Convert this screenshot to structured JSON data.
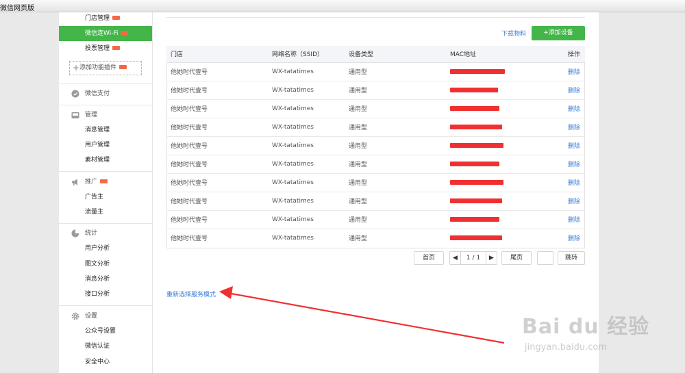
{
  "window": {
    "title": "微信网页版"
  },
  "sidebar": {
    "top_items": [
      {
        "label": "门店管理",
        "badge": true
      },
      {
        "label": "微信连Wi-Fi",
        "badge": true,
        "active": true
      },
      {
        "label": "投票管理",
        "badge": true
      }
    ],
    "add_plugin_label": "添加功能插件",
    "sections": [
      {
        "title": "微信支付",
        "icon": "wallet-icon",
        "items": []
      },
      {
        "title": "管理",
        "icon": "inbox-icon",
        "items": [
          "消息管理",
          "用户管理",
          "素材管理"
        ]
      },
      {
        "title": "推广",
        "icon": "megaphone-icon",
        "badge": true,
        "items": [
          "广告主",
          "流量主"
        ]
      },
      {
        "title": "统计",
        "icon": "pie-chart-icon",
        "items": [
          "用户分析",
          "图文分析",
          "消息分析",
          "接口分析"
        ]
      },
      {
        "title": "设置",
        "icon": "gear-icon",
        "items": [
          "公众号设置",
          "微信认证",
          "安全中心"
        ]
      }
    ]
  },
  "toolbar": {
    "download_label": "下载物料",
    "add_device_label": "添加设备"
  },
  "table": {
    "columns": [
      "门店",
      "网络名称（SSID）",
      "设备类型",
      "MAC地址",
      "操作"
    ],
    "rows": [
      {
        "store": "他她时代壹号",
        "ssid": "WX-tatatimes",
        "type": "通用型",
        "op": "删除"
      },
      {
        "store": "他她时代壹号",
        "ssid": "WX-tatatimes",
        "type": "通用型",
        "op": "删除"
      },
      {
        "store": "他她时代壹号",
        "ssid": "WX-tatatimes",
        "type": "通用型",
        "op": "删除"
      },
      {
        "store": "他她时代壹号",
        "ssid": "WX-tatatimes",
        "type": "通用型",
        "op": "删除"
      },
      {
        "store": "他她时代壹号",
        "ssid": "WX-tatatimes",
        "type": "通用型",
        "op": "删除"
      },
      {
        "store": "他她时代壹号",
        "ssid": "WX-tatatimes",
        "type": "通用型",
        "op": "删除"
      },
      {
        "store": "他她时代壹号",
        "ssid": "WX-tatatimes",
        "type": "通用型",
        "op": "删除"
      },
      {
        "store": "他她时代壹号",
        "ssid": "WX-tatatimes",
        "type": "通用型",
        "op": "删除"
      },
      {
        "store": "他她时代壹号",
        "ssid": "WX-tatatimes",
        "type": "通用型",
        "op": "删除"
      },
      {
        "store": "他她时代壹号",
        "ssid": "WX-tatatimes",
        "type": "通用型",
        "op": "删除"
      }
    ]
  },
  "pagination": {
    "first": "首页",
    "page": "1 / 1",
    "last": "尾页",
    "goto_value": "",
    "jump": "跳转"
  },
  "reselect_label": "重新选择服务模式",
  "watermark": {
    "brand": "Bai du 经验",
    "url": "jingyan.baidu.com"
  },
  "colors": {
    "accent": "#44b549",
    "link": "#3b7dd8",
    "badge": "#f26a45",
    "annotation": "#f03030"
  }
}
